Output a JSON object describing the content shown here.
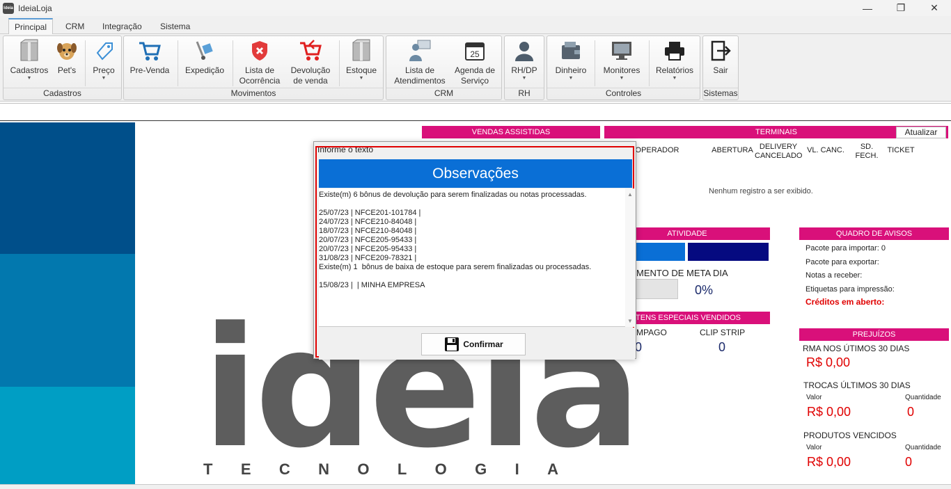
{
  "window": {
    "title": "IdeiaLoja",
    "icon_text": "Ideia"
  },
  "tabs": [
    "Principal",
    "CRM",
    "Integração",
    "Sistema"
  ],
  "ribbon": {
    "cadastros": {
      "label": "Cadastros",
      "buttons": [
        "Cadastros",
        "Pet's",
        "Preço"
      ]
    },
    "movimentos": {
      "label": "Movimentos",
      "buttons": [
        "Pre-Venda",
        "Expedição",
        "Lista de Ocorrência",
        "Devolução de venda",
        "Estoque"
      ]
    },
    "crm": {
      "label": "CRM",
      "buttons": [
        "Lista de Atendimentos",
        "Agenda de Serviço"
      ]
    },
    "rh": {
      "label": "RH",
      "buttons": [
        "RH/DP"
      ]
    },
    "controles": {
      "label": "Controles",
      "buttons": [
        "Dinheiro",
        "Monitores",
        "Relatórios"
      ]
    },
    "sistemas": {
      "label": "Sistemas",
      "buttons": [
        "Sair"
      ]
    }
  },
  "calendar_day": "25",
  "logo": {
    "word": "ideia",
    "sub": "TECNOLOGIA"
  },
  "dashboard": {
    "vendas_assistidas": "VENDAS ASSISTIDAS",
    "terminais": {
      "title": "TERMINAIS",
      "refresh": "Atualizar",
      "columns": [
        "OPERADOR",
        "ABERTURA",
        "DELIVERY CANCELADO",
        "VL. CANC.",
        "SD. FECH.",
        "TICKET"
      ],
      "empty": "Nenhum registro a ser exibido."
    },
    "atividade": "ATIVIDADE",
    "meta": {
      "label": "MENTO DE META DIA",
      "value": "0%"
    },
    "itens_especiais": {
      "title": "ITENS ESPECIAIS VENDIDOS",
      "col1": "MPAGO",
      "col1_value": "0",
      "col2": "CLIP STRIP",
      "col2_value": "0"
    },
    "avisos": {
      "title": "QUADRO DE AVISOS",
      "items": [
        "Pacote para importar: 0",
        "Pacote para exportar:",
        "Notas a receber:",
        "Etiquetas para impressão:"
      ],
      "alert": "Créditos em aberto:"
    },
    "prejuizos": {
      "title": "PREJUÍZOS",
      "rma_label": "RMA NOS ÚTIMOS 30 DIAS",
      "rma_value": "R$ 0,00",
      "trocas_label": "TROCAS ÚLTIMOS 30 DIAS",
      "valor_label": "Valor",
      "qtd_label": "Quantidade",
      "trocas_value": "R$ 0,00",
      "trocas_qtd": "0",
      "vencidos_label": "PRODUTOS VENCIDOS",
      "vencidos_value": "R$ 0,00",
      "vencidos_qtd": "0"
    }
  },
  "modal": {
    "caption": "Informe o texto",
    "title": "Observações",
    "lines": [
      "Existe(m) 6 bônus de devolução para serem finalizadas ou notas processadas.",
      "",
      "25/07/23 | NFCE201-101784 |",
      "24/07/23 | NFCE210-84048 |",
      "18/07/23 | NFCE210-84048 |",
      "20/07/23 | NFCE205-95433 |",
      "20/07/23 | NFCE205-95433 |",
      "31/08/23 | NFCE209-78321 |",
      "Existe(m) 1  bônus de baixa de estoque para serem finalizadas ou processadas.",
      "",
      "15/08/23 |  | MINHA EMPRESA"
    ],
    "confirm": "Confirmar"
  },
  "colors": {
    "accent": "#d9107a",
    "band1": "#004f8a",
    "band2": "#0278ae",
    "band3": "#009ec4",
    "header_blue": "#0a6fd6"
  }
}
